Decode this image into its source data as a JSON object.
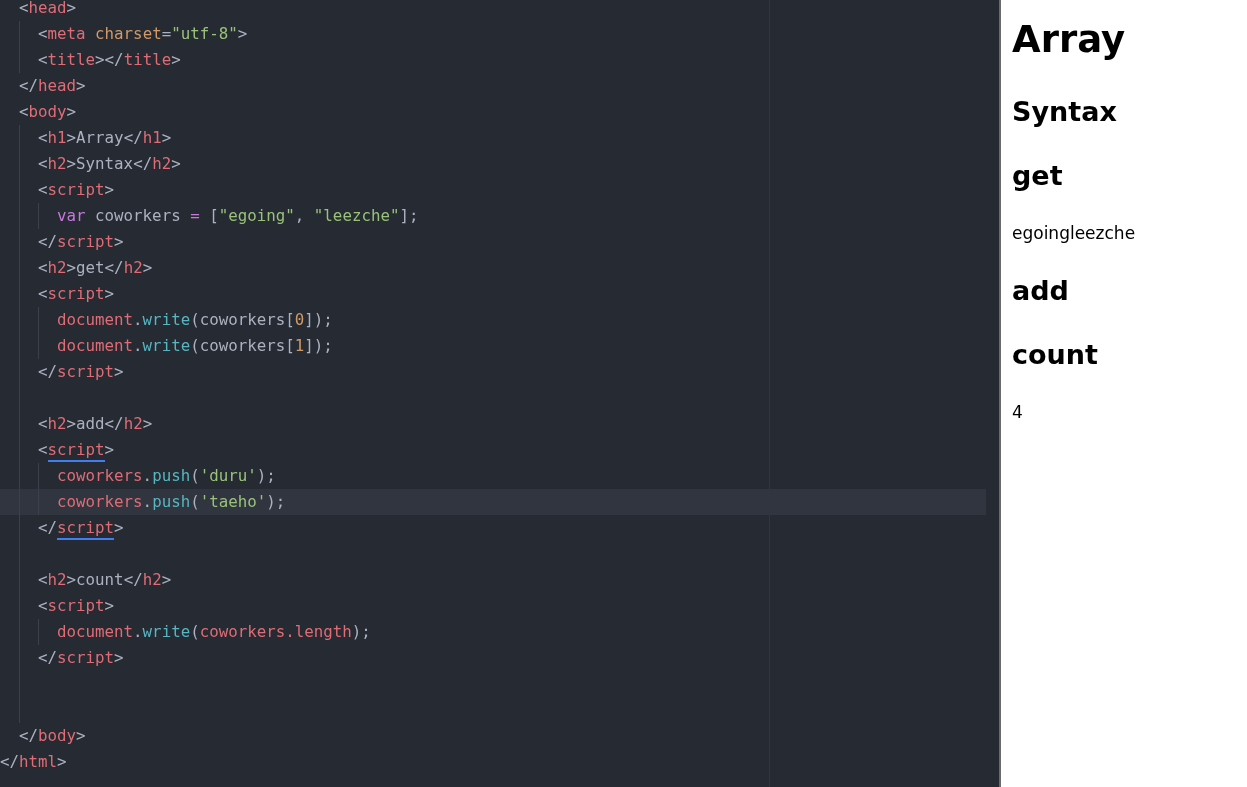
{
  "editor": {
    "lines": [
      {
        "children": [
          {
            "highlighted": false,
            "tokens": [
              {
                "kind": "punct",
                "text": "<"
              },
              {
                "kind": "tag",
                "text": "head"
              },
              {
                "kind": "punct",
                "text": ">"
              }
            ],
            "children": [
              {
                "highlighted": false,
                "tokens": [
                  {
                    "kind": "punct",
                    "text": "<"
                  },
                  {
                    "kind": "tag",
                    "text": "meta"
                  },
                  {
                    "kind": "attr",
                    "text": " charset"
                  },
                  {
                    "kind": "punct",
                    "text": "="
                  },
                  {
                    "kind": "string",
                    "text": "\"utf-8\""
                  },
                  {
                    "kind": "punct",
                    "text": ">"
                  }
                ]
              },
              {
                "highlighted": false,
                "tokens": [
                  {
                    "kind": "punct",
                    "text": "<"
                  },
                  {
                    "kind": "tag",
                    "text": "title"
                  },
                  {
                    "kind": "punct",
                    "text": "></"
                  },
                  {
                    "kind": "tag",
                    "text": "title"
                  },
                  {
                    "kind": "punct",
                    "text": ">"
                  }
                ]
              }
            ]
          },
          {
            "highlighted": false,
            "tokens": [
              {
                "kind": "punct",
                "text": "</"
              },
              {
                "kind": "tag",
                "text": "head"
              },
              {
                "kind": "punct",
                "text": ">"
              }
            ]
          },
          {
            "highlighted": false,
            "tokens": [
              {
                "kind": "punct",
                "text": "<"
              },
              {
                "kind": "tag",
                "text": "body"
              },
              {
                "kind": "punct",
                "text": ">"
              }
            ],
            "children": [
              {
                "highlighted": false,
                "tokens": [
                  {
                    "kind": "punct",
                    "text": "<"
                  },
                  {
                    "kind": "tag",
                    "text": "h1"
                  },
                  {
                    "kind": "punct",
                    "text": ">"
                  },
                  {
                    "kind": "plain",
                    "text": "Array"
                  },
                  {
                    "kind": "punct",
                    "text": "</"
                  },
                  {
                    "kind": "tag",
                    "text": "h1"
                  },
                  {
                    "kind": "punct",
                    "text": ">"
                  }
                ]
              },
              {
                "highlighted": false,
                "tokens": [
                  {
                    "kind": "punct",
                    "text": "<"
                  },
                  {
                    "kind": "tag",
                    "text": "h2"
                  },
                  {
                    "kind": "punct",
                    "text": ">"
                  },
                  {
                    "kind": "plain",
                    "text": "Syntax"
                  },
                  {
                    "kind": "punct",
                    "text": "</"
                  },
                  {
                    "kind": "tag",
                    "text": "h2"
                  },
                  {
                    "kind": "punct",
                    "text": ">"
                  }
                ]
              },
              {
                "highlighted": false,
                "tokens": [
                  {
                    "kind": "punct",
                    "text": "<"
                  },
                  {
                    "kind": "tag",
                    "text": "script"
                  },
                  {
                    "kind": "punct",
                    "text": ">"
                  }
                ],
                "children": [
                  {
                    "highlighted": false,
                    "tokens": [
                      {
                        "kind": "keyword",
                        "text": "var"
                      },
                      {
                        "kind": "plain",
                        "text": " coworkers "
                      },
                      {
                        "kind": "keyword",
                        "text": "="
                      },
                      {
                        "kind": "plain",
                        "text": " ["
                      },
                      {
                        "kind": "string",
                        "text": "\"egoing\""
                      },
                      {
                        "kind": "plain",
                        "text": ", "
                      },
                      {
                        "kind": "string",
                        "text": "\"leezche\""
                      },
                      {
                        "kind": "plain",
                        "text": "];"
                      }
                    ]
                  }
                ]
              },
              {
                "highlighted": false,
                "tokens": [
                  {
                    "kind": "punct",
                    "text": "</"
                  },
                  {
                    "kind": "tag",
                    "text": "script"
                  },
                  {
                    "kind": "punct",
                    "text": ">"
                  }
                ]
              },
              {
                "highlighted": false,
                "tokens": [
                  {
                    "kind": "punct",
                    "text": "<"
                  },
                  {
                    "kind": "tag",
                    "text": "h2"
                  },
                  {
                    "kind": "punct",
                    "text": ">"
                  },
                  {
                    "kind": "plain",
                    "text": "get"
                  },
                  {
                    "kind": "punct",
                    "text": "</"
                  },
                  {
                    "kind": "tag",
                    "text": "h2"
                  },
                  {
                    "kind": "punct",
                    "text": ">"
                  }
                ]
              },
              {
                "highlighted": false,
                "tokens": [
                  {
                    "kind": "punct",
                    "text": "<"
                  },
                  {
                    "kind": "tag",
                    "text": "script"
                  },
                  {
                    "kind": "punct",
                    "text": ">"
                  }
                ],
                "children": [
                  {
                    "highlighted": false,
                    "tokens": [
                      {
                        "kind": "variable",
                        "text": "document"
                      },
                      {
                        "kind": "plain",
                        "text": "."
                      },
                      {
                        "kind": "method",
                        "text": "write"
                      },
                      {
                        "kind": "plain",
                        "text": "(coworkers["
                      },
                      {
                        "kind": "number",
                        "text": "0"
                      },
                      {
                        "kind": "plain",
                        "text": "]);"
                      }
                    ]
                  },
                  {
                    "highlighted": false,
                    "tokens": [
                      {
                        "kind": "variable",
                        "text": "document"
                      },
                      {
                        "kind": "plain",
                        "text": "."
                      },
                      {
                        "kind": "method",
                        "text": "write"
                      },
                      {
                        "kind": "plain",
                        "text": "(coworkers["
                      },
                      {
                        "kind": "number",
                        "text": "1"
                      },
                      {
                        "kind": "plain",
                        "text": "]);"
                      }
                    ]
                  }
                ]
              },
              {
                "highlighted": false,
                "tokens": [
                  {
                    "kind": "punct",
                    "text": "</"
                  },
                  {
                    "kind": "tag",
                    "text": "script"
                  },
                  {
                    "kind": "punct",
                    "text": ">"
                  }
                ]
              },
              {
                "highlighted": false
              },
              {
                "highlighted": false,
                "tokens": [
                  {
                    "kind": "punct",
                    "text": "<"
                  },
                  {
                    "kind": "tag",
                    "text": "h2"
                  },
                  {
                    "kind": "punct",
                    "text": ">"
                  },
                  {
                    "kind": "plain",
                    "text": "add"
                  },
                  {
                    "kind": "punct",
                    "text": "</"
                  },
                  {
                    "kind": "tag",
                    "text": "h2"
                  },
                  {
                    "kind": "punct",
                    "text": ">"
                  }
                ]
              },
              {
                "highlighted": false,
                "tokens": [
                  {
                    "kind": "punct",
                    "text": "<"
                  },
                  {
                    "kind": "tag",
                    "text": "script",
                    "underlined": true
                  },
                  {
                    "kind": "punct",
                    "text": ">"
                  }
                ],
                "children": [
                  {
                    "highlighted": false,
                    "tokens": [
                      {
                        "kind": "variable",
                        "text": "coworkers"
                      },
                      {
                        "kind": "plain",
                        "text": "."
                      },
                      {
                        "kind": "method",
                        "text": "push"
                      },
                      {
                        "kind": "plain",
                        "text": "("
                      },
                      {
                        "kind": "string",
                        "text": "'duru'"
                      },
                      {
                        "kind": "plain",
                        "text": ");"
                      }
                    ]
                  },
                  {
                    "highlighted": true,
                    "tokens": [
                      {
                        "kind": "variable",
                        "text": "coworkers"
                      },
                      {
                        "kind": "plain",
                        "text": "."
                      },
                      {
                        "kind": "method",
                        "text": "push"
                      },
                      {
                        "kind": "plain",
                        "text": "("
                      },
                      {
                        "kind": "string",
                        "text": "'taeho'"
                      },
                      {
                        "kind": "plain",
                        "text": ");"
                      }
                    ]
                  }
                ]
              },
              {
                "highlighted": false,
                "tokens": [
                  {
                    "kind": "punct",
                    "text": "</"
                  },
                  {
                    "kind": "tag",
                    "text": "script",
                    "underlined": true
                  },
                  {
                    "kind": "punct",
                    "text": ">"
                  }
                ]
              },
              {
                "highlighted": false
              },
              {
                "highlighted": false,
                "tokens": [
                  {
                    "kind": "punct",
                    "text": "<"
                  },
                  {
                    "kind": "tag",
                    "text": "h2"
                  },
                  {
                    "kind": "punct",
                    "text": ">"
                  },
                  {
                    "kind": "plain",
                    "text": "count"
                  },
                  {
                    "kind": "punct",
                    "text": "</"
                  },
                  {
                    "kind": "tag",
                    "text": "h2"
                  },
                  {
                    "kind": "punct",
                    "text": ">"
                  }
                ]
              },
              {
                "highlighted": false,
                "tokens": [
                  {
                    "kind": "punct",
                    "text": "<"
                  },
                  {
                    "kind": "tag",
                    "text": "script"
                  },
                  {
                    "kind": "punct",
                    "text": ">"
                  }
                ],
                "children": [
                  {
                    "highlighted": false,
                    "tokens": [
                      {
                        "kind": "variable",
                        "text": "document"
                      },
                      {
                        "kind": "plain",
                        "text": "."
                      },
                      {
                        "kind": "method",
                        "text": "write"
                      },
                      {
                        "kind": "plain",
                        "text": "("
                      },
                      {
                        "kind": "variable",
                        "text": "coworkers.length"
                      },
                      {
                        "kind": "plain",
                        "text": ");"
                      }
                    ]
                  }
                ]
              },
              {
                "highlighted": false,
                "tokens": [
                  {
                    "kind": "punct",
                    "text": "</"
                  },
                  {
                    "kind": "tag",
                    "text": "script"
                  },
                  {
                    "kind": "punct",
                    "text": ">"
                  }
                ]
              },
              {
                "highlighted": false
              },
              {
                "highlighted": false
              }
            ]
          },
          {
            "highlighted": false,
            "tokens": [
              {
                "kind": "punct",
                "text": "</"
              },
              {
                "kind": "tag",
                "text": "body"
              },
              {
                "kind": "punct",
                "text": ">"
              }
            ]
          }
        ]
      },
      {
        "highlighted": false,
        "tokens": [
          {
            "kind": "punct",
            "text": "</"
          },
          {
            "kind": "tag",
            "text": "html"
          },
          {
            "kind": "punct",
            "text": ">"
          }
        ]
      }
    ]
  },
  "preview": {
    "items": [
      {
        "kind": "h1",
        "text": "Array"
      },
      {
        "kind": "h2",
        "text": "Syntax"
      },
      {
        "kind": "h2",
        "text": "get"
      },
      {
        "kind": "text",
        "text": "egoingleezche"
      },
      {
        "kind": "h2",
        "text": "add"
      },
      {
        "kind": "h2",
        "text": "count"
      },
      {
        "kind": "text",
        "text": "4"
      }
    ]
  }
}
